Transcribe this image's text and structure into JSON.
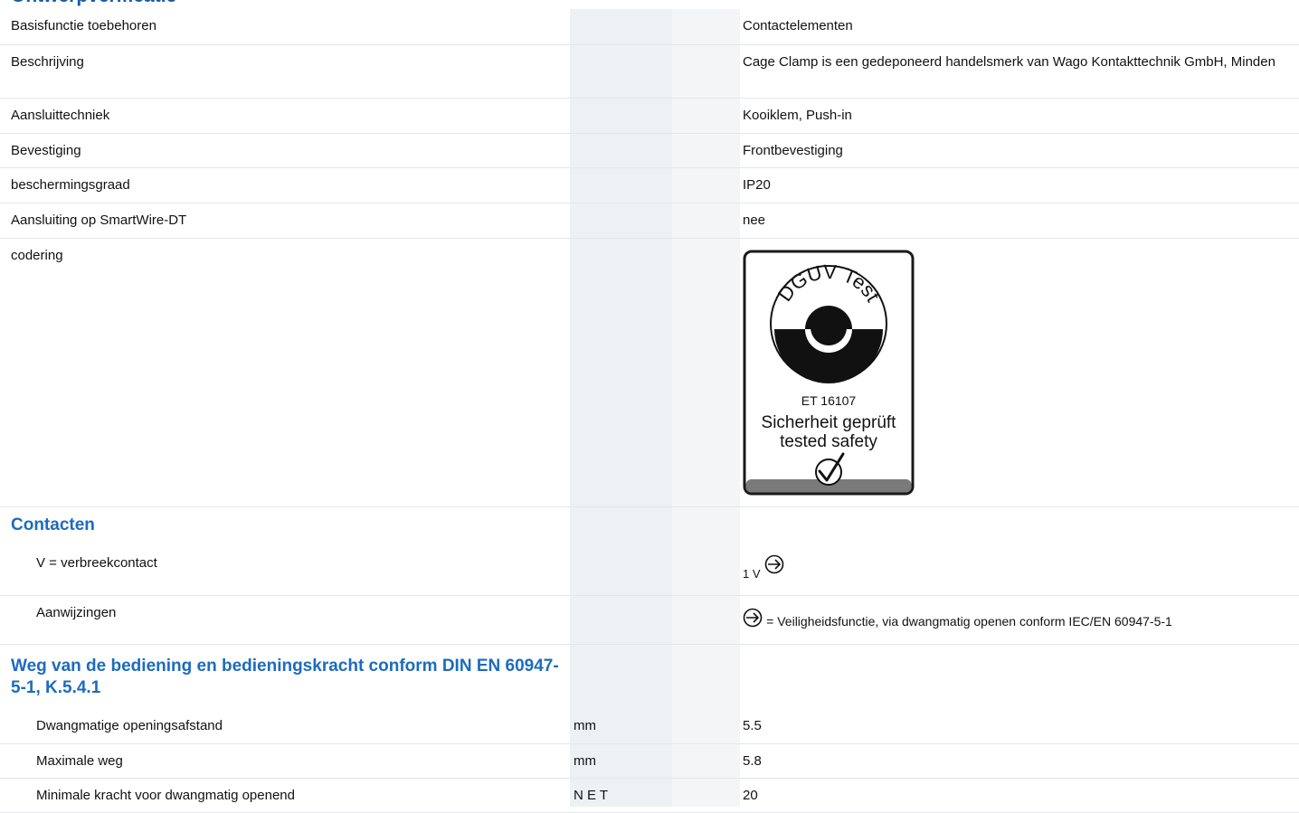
{
  "top_heading": "Ontwerpverificatie",
  "rows": [
    {
      "label": "Basisfunctie toebehoren",
      "value": "Contactelementen"
    },
    {
      "label": "Beschrijving",
      "value": "Cage Clamp is een gedeponeerd handelsmerk van Wago Kontakttechnik GmbH, Minden"
    },
    {
      "label": "Aansluittechniek",
      "value": "Kooiklem, Push-in"
    },
    {
      "label": "Bevestiging",
      "value": "Frontbevestiging"
    },
    {
      "label": "beschermingsgraad",
      "value": "IP20"
    },
    {
      "label": "Aansluiting op SmartWire-DT",
      "value": "nee"
    },
    {
      "label": "codering"
    }
  ],
  "badge": {
    "top_text": "DGUV Test",
    "cert": "ET 16107",
    "line1": "Sicherheit geprüft",
    "line2": "tested safety"
  },
  "contacten": {
    "title": "Contacten",
    "v_label": "V = verbreekcontact",
    "v_prefix": "1 V",
    "aanwijzingen_label": "Aanwijzingen",
    "aanwijzingen_text": "= Veiligheidsfunctie, via dwangmatig openen conform IEC/EN 60947-5-1"
  },
  "weg": {
    "title": "Weg van de bediening en bedieningskracht conform DIN EN 60947-5-1, K.5.4.1",
    "rows": [
      {
        "label": "Dwangmatige openingsafstand",
        "unit": "mm",
        "value": "5.5"
      },
      {
        "label": "Maximale weg",
        "unit": "mm",
        "value": "5.8"
      },
      {
        "label": "Minimale kracht voor dwangmatig openend",
        "unit": "N E T",
        "value": "20"
      }
    ]
  },
  "colors": {
    "heading": "#1c6bbf",
    "band": "#eef1f4",
    "border": "#e4e6e9"
  },
  "icons": [
    "positive-opening-symbol",
    "dguv-test-badge",
    "checkmark-icon"
  ]
}
